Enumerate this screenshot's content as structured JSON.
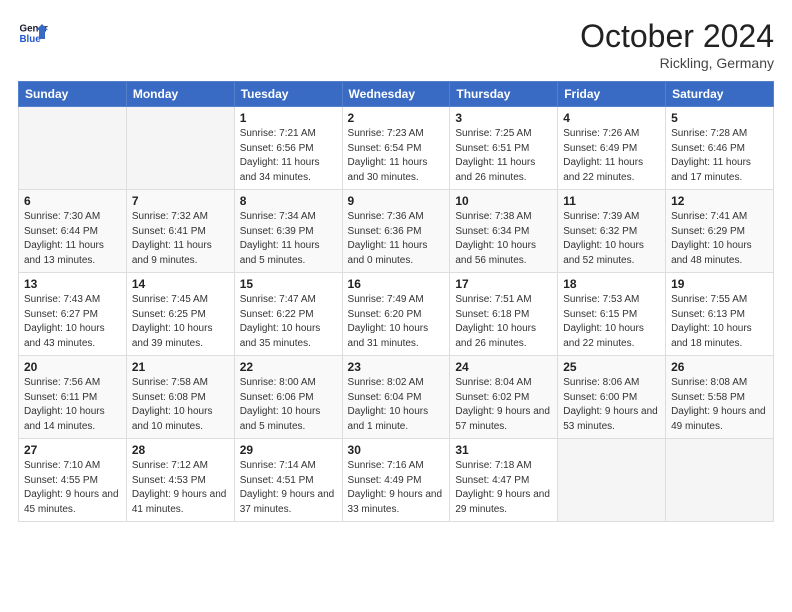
{
  "header": {
    "logo_line1": "General",
    "logo_line2": "Blue",
    "month": "October 2024",
    "location": "Rickling, Germany"
  },
  "weekdays": [
    "Sunday",
    "Monday",
    "Tuesday",
    "Wednesday",
    "Thursday",
    "Friday",
    "Saturday"
  ],
  "weeks": [
    [
      {
        "day": "",
        "sunrise": "",
        "sunset": "",
        "daylight": ""
      },
      {
        "day": "",
        "sunrise": "",
        "sunset": "",
        "daylight": ""
      },
      {
        "day": "1",
        "sunrise": "Sunrise: 7:21 AM",
        "sunset": "Sunset: 6:56 PM",
        "daylight": "Daylight: 11 hours and 34 minutes."
      },
      {
        "day": "2",
        "sunrise": "Sunrise: 7:23 AM",
        "sunset": "Sunset: 6:54 PM",
        "daylight": "Daylight: 11 hours and 30 minutes."
      },
      {
        "day": "3",
        "sunrise": "Sunrise: 7:25 AM",
        "sunset": "Sunset: 6:51 PM",
        "daylight": "Daylight: 11 hours and 26 minutes."
      },
      {
        "day": "4",
        "sunrise": "Sunrise: 7:26 AM",
        "sunset": "Sunset: 6:49 PM",
        "daylight": "Daylight: 11 hours and 22 minutes."
      },
      {
        "day": "5",
        "sunrise": "Sunrise: 7:28 AM",
        "sunset": "Sunset: 6:46 PM",
        "daylight": "Daylight: 11 hours and 17 minutes."
      }
    ],
    [
      {
        "day": "6",
        "sunrise": "Sunrise: 7:30 AM",
        "sunset": "Sunset: 6:44 PM",
        "daylight": "Daylight: 11 hours and 13 minutes."
      },
      {
        "day": "7",
        "sunrise": "Sunrise: 7:32 AM",
        "sunset": "Sunset: 6:41 PM",
        "daylight": "Daylight: 11 hours and 9 minutes."
      },
      {
        "day": "8",
        "sunrise": "Sunrise: 7:34 AM",
        "sunset": "Sunset: 6:39 PM",
        "daylight": "Daylight: 11 hours and 5 minutes."
      },
      {
        "day": "9",
        "sunrise": "Sunrise: 7:36 AM",
        "sunset": "Sunset: 6:36 PM",
        "daylight": "Daylight: 11 hours and 0 minutes."
      },
      {
        "day": "10",
        "sunrise": "Sunrise: 7:38 AM",
        "sunset": "Sunset: 6:34 PM",
        "daylight": "Daylight: 10 hours and 56 minutes."
      },
      {
        "day": "11",
        "sunrise": "Sunrise: 7:39 AM",
        "sunset": "Sunset: 6:32 PM",
        "daylight": "Daylight: 10 hours and 52 minutes."
      },
      {
        "day": "12",
        "sunrise": "Sunrise: 7:41 AM",
        "sunset": "Sunset: 6:29 PM",
        "daylight": "Daylight: 10 hours and 48 minutes."
      }
    ],
    [
      {
        "day": "13",
        "sunrise": "Sunrise: 7:43 AM",
        "sunset": "Sunset: 6:27 PM",
        "daylight": "Daylight: 10 hours and 43 minutes."
      },
      {
        "day": "14",
        "sunrise": "Sunrise: 7:45 AM",
        "sunset": "Sunset: 6:25 PM",
        "daylight": "Daylight: 10 hours and 39 minutes."
      },
      {
        "day": "15",
        "sunrise": "Sunrise: 7:47 AM",
        "sunset": "Sunset: 6:22 PM",
        "daylight": "Daylight: 10 hours and 35 minutes."
      },
      {
        "day": "16",
        "sunrise": "Sunrise: 7:49 AM",
        "sunset": "Sunset: 6:20 PM",
        "daylight": "Daylight: 10 hours and 31 minutes."
      },
      {
        "day": "17",
        "sunrise": "Sunrise: 7:51 AM",
        "sunset": "Sunset: 6:18 PM",
        "daylight": "Daylight: 10 hours and 26 minutes."
      },
      {
        "day": "18",
        "sunrise": "Sunrise: 7:53 AM",
        "sunset": "Sunset: 6:15 PM",
        "daylight": "Daylight: 10 hours and 22 minutes."
      },
      {
        "day": "19",
        "sunrise": "Sunrise: 7:55 AM",
        "sunset": "Sunset: 6:13 PM",
        "daylight": "Daylight: 10 hours and 18 minutes."
      }
    ],
    [
      {
        "day": "20",
        "sunrise": "Sunrise: 7:56 AM",
        "sunset": "Sunset: 6:11 PM",
        "daylight": "Daylight: 10 hours and 14 minutes."
      },
      {
        "day": "21",
        "sunrise": "Sunrise: 7:58 AM",
        "sunset": "Sunset: 6:08 PM",
        "daylight": "Daylight: 10 hours and 10 minutes."
      },
      {
        "day": "22",
        "sunrise": "Sunrise: 8:00 AM",
        "sunset": "Sunset: 6:06 PM",
        "daylight": "Daylight: 10 hours and 5 minutes."
      },
      {
        "day": "23",
        "sunrise": "Sunrise: 8:02 AM",
        "sunset": "Sunset: 6:04 PM",
        "daylight": "Daylight: 10 hours and 1 minute."
      },
      {
        "day": "24",
        "sunrise": "Sunrise: 8:04 AM",
        "sunset": "Sunset: 6:02 PM",
        "daylight": "Daylight: 9 hours and 57 minutes."
      },
      {
        "day": "25",
        "sunrise": "Sunrise: 8:06 AM",
        "sunset": "Sunset: 6:00 PM",
        "daylight": "Daylight: 9 hours and 53 minutes."
      },
      {
        "day": "26",
        "sunrise": "Sunrise: 8:08 AM",
        "sunset": "Sunset: 5:58 PM",
        "daylight": "Daylight: 9 hours and 49 minutes."
      }
    ],
    [
      {
        "day": "27",
        "sunrise": "Sunrise: 7:10 AM",
        "sunset": "Sunset: 4:55 PM",
        "daylight": "Daylight: 9 hours and 45 minutes."
      },
      {
        "day": "28",
        "sunrise": "Sunrise: 7:12 AM",
        "sunset": "Sunset: 4:53 PM",
        "daylight": "Daylight: 9 hours and 41 minutes."
      },
      {
        "day": "29",
        "sunrise": "Sunrise: 7:14 AM",
        "sunset": "Sunset: 4:51 PM",
        "daylight": "Daylight: 9 hours and 37 minutes."
      },
      {
        "day": "30",
        "sunrise": "Sunrise: 7:16 AM",
        "sunset": "Sunset: 4:49 PM",
        "daylight": "Daylight: 9 hours and 33 minutes."
      },
      {
        "day": "31",
        "sunrise": "Sunrise: 7:18 AM",
        "sunset": "Sunset: 4:47 PM",
        "daylight": "Daylight: 9 hours and 29 minutes."
      },
      {
        "day": "",
        "sunrise": "",
        "sunset": "",
        "daylight": ""
      },
      {
        "day": "",
        "sunrise": "",
        "sunset": "",
        "daylight": ""
      }
    ]
  ]
}
